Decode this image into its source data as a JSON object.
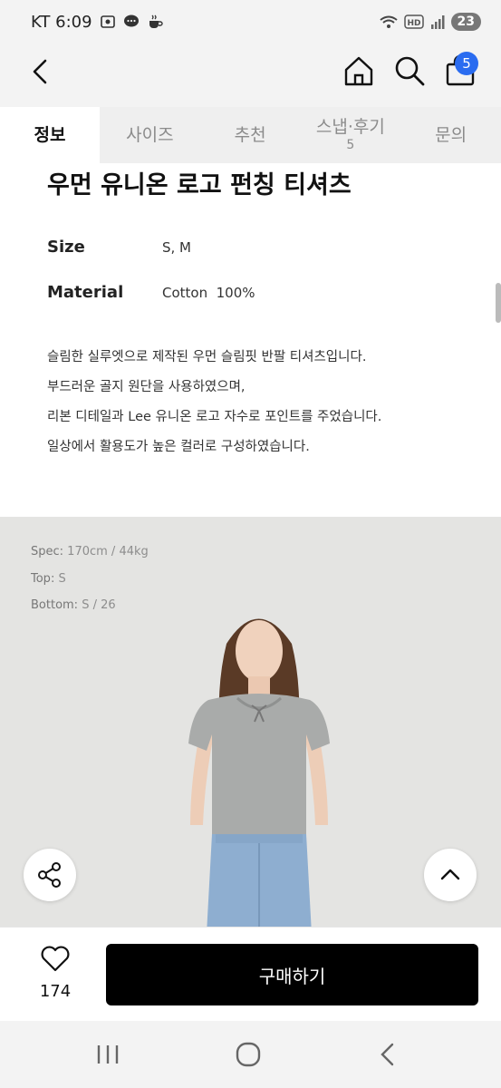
{
  "status_bar": {
    "carrier_time": "KT 6:09",
    "left_icons": [
      "screenshot-icon",
      "chat-icon",
      "cafe-icon"
    ],
    "right_icons": [
      "wifi-icon",
      "hd-icon",
      "signal-icon"
    ],
    "battery": "23"
  },
  "header": {
    "back_icon": "chevron-left-icon",
    "home_icon": "home-icon",
    "search_icon": "search-icon",
    "cart_icon": "shopping-bag-icon",
    "cart_count": "5"
  },
  "tabs": [
    {
      "label": "정보",
      "sub": ""
    },
    {
      "label": "사이즈",
      "sub": ""
    },
    {
      "label": "추천",
      "sub": ""
    },
    {
      "label": "스냅·후기",
      "sub": "5"
    },
    {
      "label": "문의",
      "sub": ""
    }
  ],
  "product": {
    "title": "우먼 유니온 로고 펀칭 티셔츠",
    "size_label": "Size",
    "size_value": "S, M",
    "material_label": "Material",
    "material_value": "Cotton  100%",
    "description": [
      "슬림한 실루엣으로 제작된 우먼 슬림핏 반팔 티셔츠입니다.",
      "부드러운 골지 원단을 사용하였으며,",
      "리본 디테일과 Lee 유니온 로고 자수로 포인트를 주었습니다.",
      "일상에서 활용도가 높은 컬러로 구성하였습니다."
    ]
  },
  "photo": {
    "spec_label": "Spec:",
    "spec_value": "170cm / 44kg",
    "top_label": "Top:",
    "top_value": "S",
    "bottom_label": "Bottom:",
    "bottom_value": "S / 26"
  },
  "actions": {
    "share_icon": "share-icon",
    "scroll_top_icon": "chevron-up-icon",
    "like_icon": "heart-icon",
    "like_count": "174",
    "buy_label": "구매하기"
  },
  "colors": {
    "accent_badge": "#2a6cf0",
    "buy_button": "#000000",
    "tab_bg": "#efefef"
  }
}
